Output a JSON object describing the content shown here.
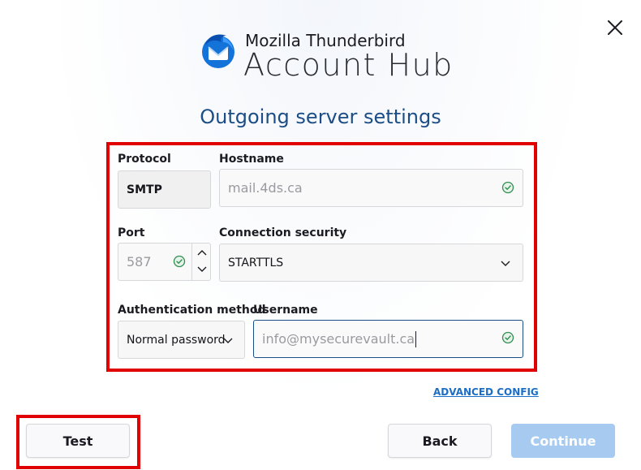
{
  "header": {
    "brand_small": "Mozilla Thunderbird",
    "brand_big": "Account Hub"
  },
  "page_title": "Outgoing server settings",
  "form": {
    "protocol": {
      "label": "Protocol",
      "value": "SMTP"
    },
    "hostname": {
      "label": "Hostname",
      "value": "mail.4ds.ca",
      "valid": true
    },
    "port": {
      "label": "Port",
      "value": "587",
      "valid": true
    },
    "connection_security": {
      "label": "Connection security",
      "value": "STARTTLS"
    },
    "auth_method": {
      "label": "Authentication method",
      "value": "Normal password"
    },
    "username": {
      "label": "Username",
      "value": "info@mysecurevault.ca",
      "valid": true
    }
  },
  "advanced_config_link": "ADVANCED CONFIG",
  "buttons": {
    "test": "Test",
    "back": "Back",
    "continue": "Continue"
  },
  "colors": {
    "title": "#1b4e86",
    "highlight": "#e00000",
    "link": "#1c6ec5",
    "continue_disabled": "#a7cbf0",
    "valid_icon": "#2f8f4f"
  },
  "icons": [
    "close-icon",
    "thunderbird-logo",
    "check-circle-icon",
    "chevron-down-icon",
    "spin-up-icon",
    "spin-down-icon"
  ]
}
